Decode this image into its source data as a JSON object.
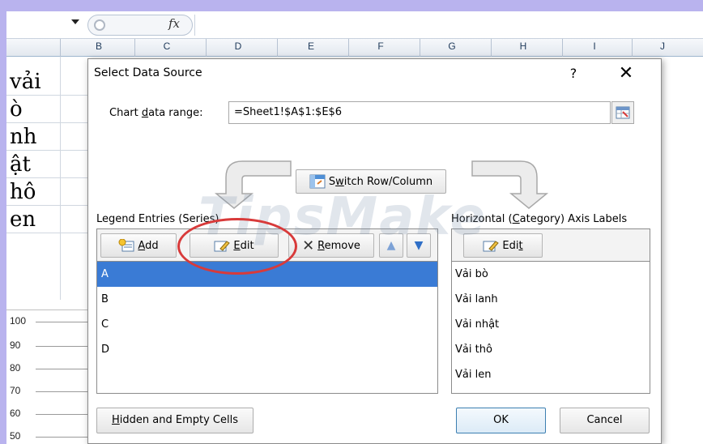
{
  "spreadsheet": {
    "columns": [
      "B",
      "C",
      "D",
      "E",
      "F",
      "G",
      "H",
      "I",
      "J"
    ],
    "row_fragments": [
      "vải",
      "ò",
      "nh",
      "ật",
      "hô",
      "en"
    ],
    "axis_ticks": [
      "100",
      "90",
      "80",
      "70",
      "60",
      "50"
    ],
    "fx_symbol": "fx"
  },
  "dialog": {
    "title": "Select Data Source",
    "help_symbol": "?",
    "close_symbol": "✕",
    "chart_range": {
      "label_pre": "Chart ",
      "label_accel": "d",
      "label_post": "ata range:",
      "value": "=Sheet1!$A$1:$E$6"
    },
    "switch_button": {
      "pre": "S",
      "accel": "w",
      "post": "itch Row/Column"
    },
    "legend": {
      "title": "Legend Entries (Series)",
      "add_accel": "A",
      "add_post": "dd",
      "edit_accel": "E",
      "edit_post": "dit",
      "remove_accel": "R",
      "remove_post": "emove",
      "items": [
        "A",
        "B",
        "C",
        "D"
      ],
      "selected_index": 0
    },
    "axis_labels": {
      "title_pre": "Horizontal (",
      "title_accel": "C",
      "title_post": "ategory) Axis Labels",
      "edit_pre": "Edi",
      "edit_accel": "t",
      "items": [
        "Vải bò",
        "Vải lanh",
        "Vải nhật",
        "Vải thô",
        "Vải len"
      ]
    },
    "hidden_cells": {
      "accel": "H",
      "post": "idden and Empty Cells"
    },
    "ok_label": "OK",
    "cancel_label": "Cancel"
  },
  "overlay": {
    "watermark_text": "TipsMake",
    "annotation_color": "#d83a3a"
  }
}
